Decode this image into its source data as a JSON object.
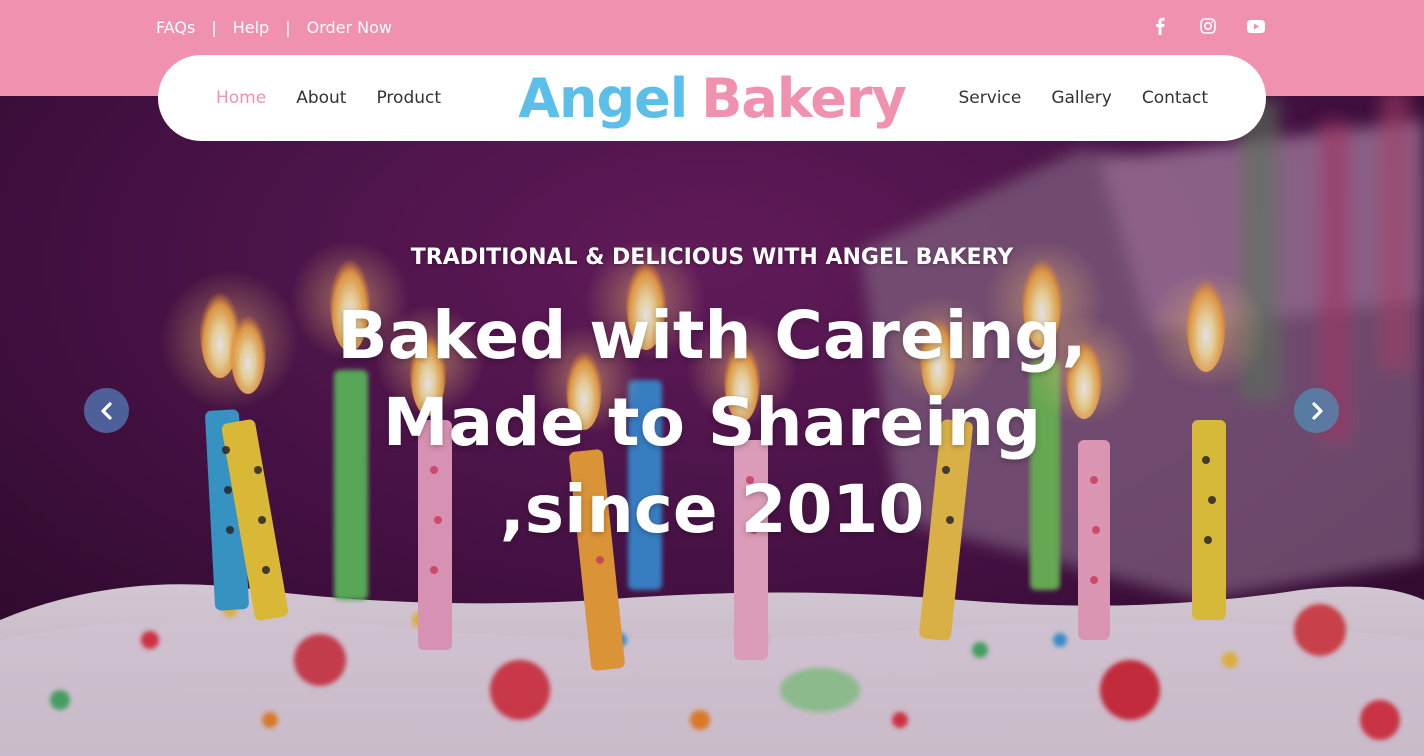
{
  "topbar": {
    "links": [
      {
        "label": "FAQs"
      },
      {
        "label": "Help"
      },
      {
        "label": "Order Now"
      }
    ],
    "separator": "|",
    "social": [
      {
        "icon": "facebook-icon"
      },
      {
        "icon": "instagram-icon"
      },
      {
        "icon": "youtube-icon"
      }
    ]
  },
  "navbar": {
    "left_items": [
      {
        "label": "Home",
        "active": true
      },
      {
        "label": "About"
      },
      {
        "label": "Product"
      }
    ],
    "brand": {
      "part1": "Angel",
      "part2": "Bakery"
    },
    "right_items": [
      {
        "label": "Service"
      },
      {
        "label": "Gallery"
      },
      {
        "label": "Contact"
      }
    ]
  },
  "hero": {
    "subtitle": "TRADITIONAL & DELICIOUS WITH ANGEL BAKERY",
    "headline_lines": [
      "Baked with Careing,",
      "Made to Shareing",
      ",since 2010"
    ],
    "prev_icon": "chevron-left-icon",
    "next_icon": "chevron-right-icon"
  },
  "colors": {
    "accent_pink": "#f191b0",
    "brand_blue": "#5bbfe9",
    "text_dark": "#333333",
    "white": "#ffffff"
  }
}
